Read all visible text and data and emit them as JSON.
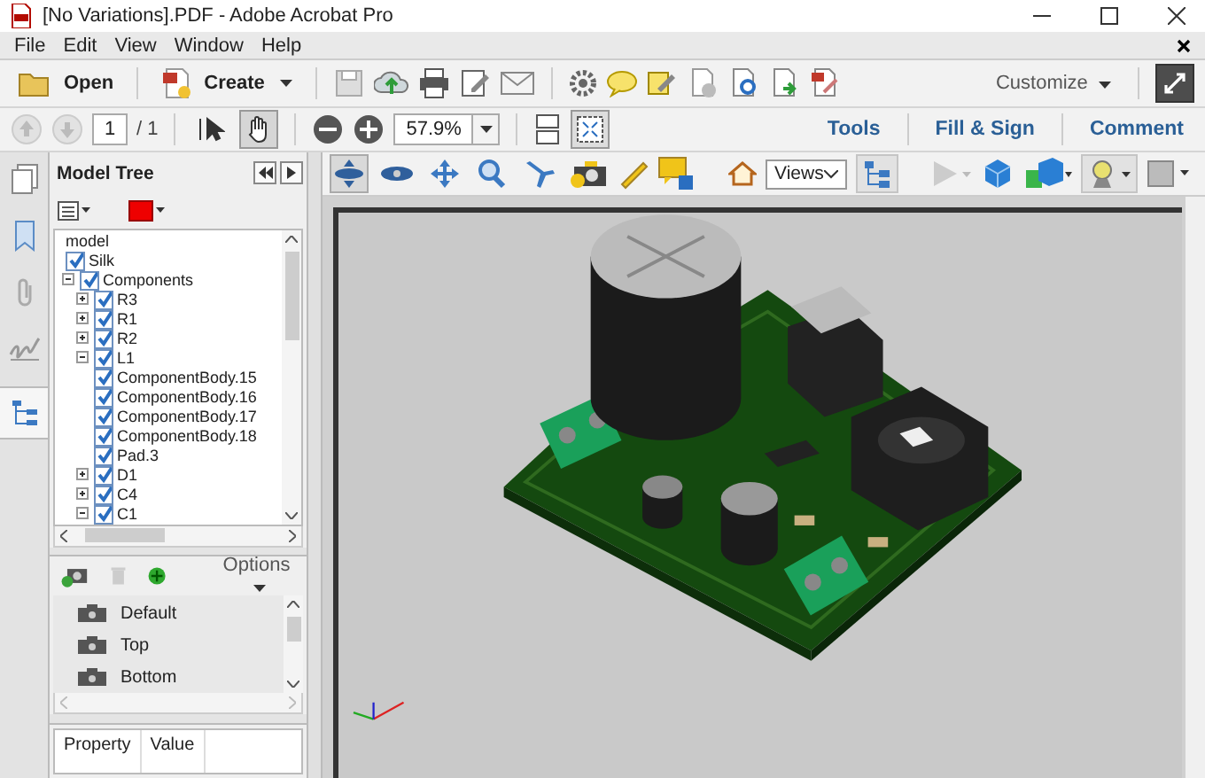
{
  "window": {
    "title": "[No Variations].PDF - Adobe Acrobat Pro"
  },
  "menu": [
    "File",
    "Edit",
    "View",
    "Window",
    "Help"
  ],
  "toolbar": {
    "open": "Open",
    "create": "Create",
    "customize": "Customize"
  },
  "nav": {
    "page": "1",
    "page_count": "/ 1",
    "zoom": "57.9%",
    "tools": [
      {
        "kind": "select",
        "selected": false
      },
      {
        "kind": "hand",
        "selected": true
      }
    ]
  },
  "task_tabs": [
    "Tools",
    "Fill & Sign",
    "Comment"
  ],
  "model_tree": {
    "title": "Model Tree",
    "root": "model",
    "nodes": [
      {
        "label": "Silk",
        "checked": true
      },
      {
        "label": "Components",
        "checked": true,
        "expanded": true,
        "children": [
          {
            "label": "R3",
            "checked": true,
            "expanded": false
          },
          {
            "label": "R1",
            "checked": true,
            "expanded": false
          },
          {
            "label": "R2",
            "checked": true,
            "expanded": false
          },
          {
            "label": "L1",
            "checked": true,
            "expanded": true,
            "children": [
              {
                "label": "ComponentBody.15",
                "checked": true
              },
              {
                "label": "ComponentBody.16",
                "checked": true
              },
              {
                "label": "ComponentBody.17",
                "checked": true
              },
              {
                "label": "ComponentBody.18",
                "checked": true
              },
              {
                "label": "Pad.3",
                "checked": true
              }
            ]
          },
          {
            "label": "D1",
            "checked": true,
            "expanded": false
          },
          {
            "label": "C4",
            "checked": true,
            "expanded": false
          },
          {
            "label": "C1",
            "checked": true,
            "expanded": true
          }
        ]
      }
    ]
  },
  "views_panel": {
    "options": "Options",
    "views": [
      "Default",
      "Top",
      "Bottom"
    ]
  },
  "properties": {
    "columns": [
      "Property",
      "Value"
    ]
  },
  "toolbar_3d": {
    "views": "Views",
    "tools": [
      {
        "kind": "rotate",
        "selected": true
      },
      {
        "kind": "spin",
        "selected": false
      },
      {
        "kind": "pan",
        "selected": false
      },
      {
        "kind": "zoom",
        "selected": false
      },
      {
        "kind": "fly",
        "selected": false
      }
    ]
  }
}
